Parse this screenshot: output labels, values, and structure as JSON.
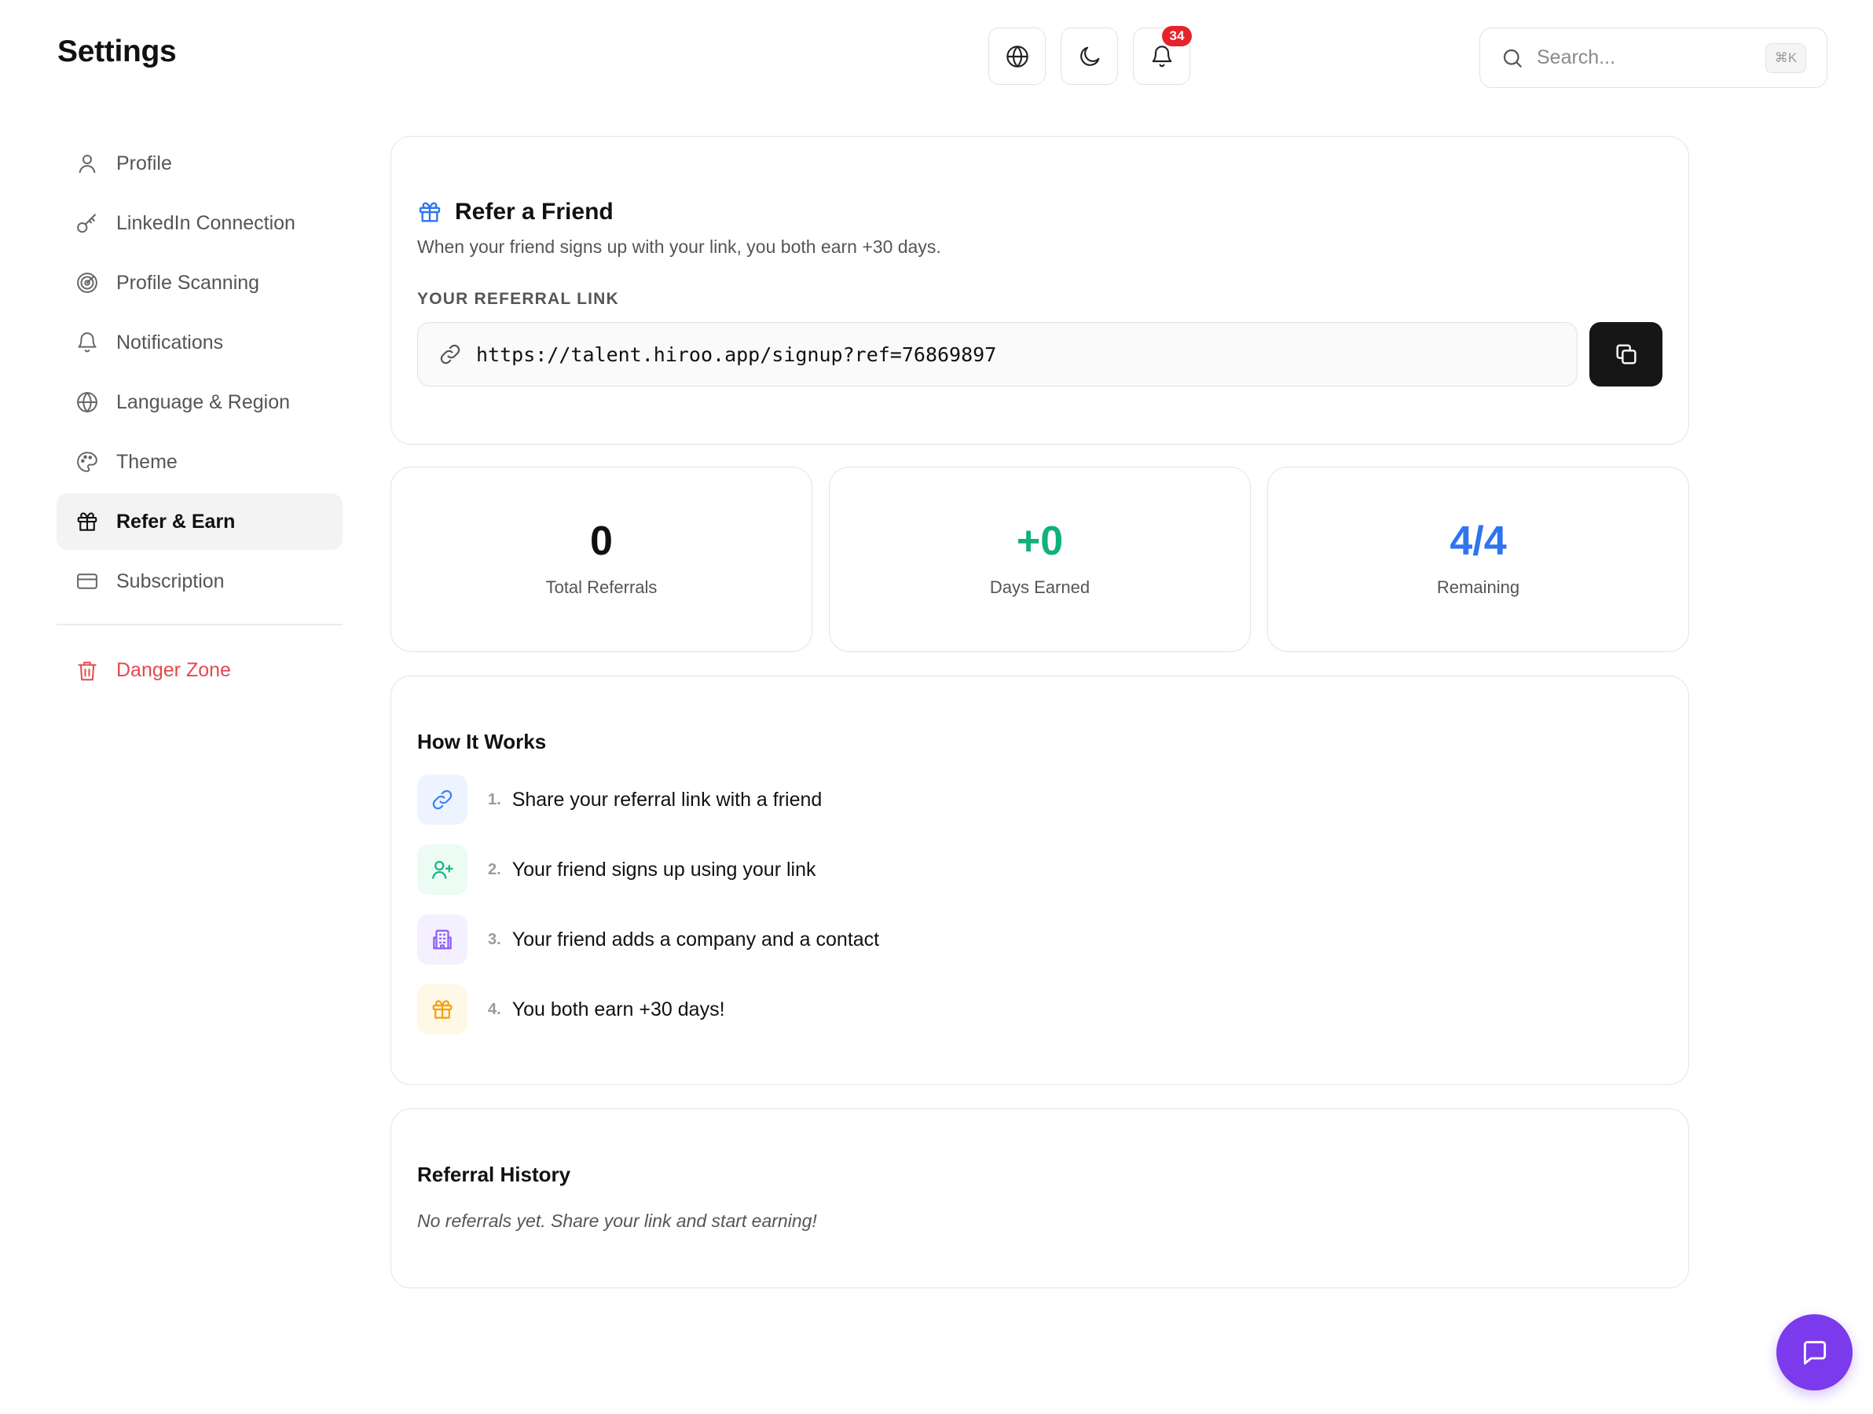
{
  "header": {
    "title": "Settings",
    "notifications_count": "34",
    "search_placeholder": "Search...",
    "search_shortcut": "⌘K"
  },
  "sidebar": {
    "items": [
      {
        "label": "Profile",
        "icon": "user-icon"
      },
      {
        "label": "LinkedIn Connection",
        "icon": "key-icon"
      },
      {
        "label": "Profile Scanning",
        "icon": "radar-icon"
      },
      {
        "label": "Notifications",
        "icon": "bell-icon"
      },
      {
        "label": "Language & Region",
        "icon": "globe-icon"
      },
      {
        "label": "Theme",
        "icon": "palette-icon"
      },
      {
        "label": "Refer & Earn",
        "icon": "gift-icon",
        "active": true
      },
      {
        "label": "Subscription",
        "icon": "credit-card-icon"
      }
    ],
    "danger": {
      "label": "Danger Zone",
      "icon": "trash-icon"
    }
  },
  "refer": {
    "title": "Refer a Friend",
    "subtitle": "When your friend signs up with your link, you both earn +30 days.",
    "link_label": "YOUR REFERRAL LINK",
    "url": "https://talent.hiroo.app/signup?ref=76869897"
  },
  "stats": [
    {
      "value": "0",
      "label": "Total Referrals",
      "color": "#111111"
    },
    {
      "value": "+0",
      "label": "Days Earned",
      "color": "#10b27a"
    },
    {
      "value": "4/4",
      "label": "Remaining",
      "color": "#2f74f0"
    }
  ],
  "how_it_works": {
    "title": "How It Works",
    "steps": [
      {
        "num": "1.",
        "text": "Share your referral link with a friend",
        "icon": "link-icon",
        "color": "#3b82f6",
        "bg": "#eef4ff"
      },
      {
        "num": "2.",
        "text": "Your friend signs up using your link",
        "icon": "user-plus-icon",
        "color": "#10b981",
        "bg": "#ecfbf4"
      },
      {
        "num": "3.",
        "text": "Your friend adds a company and a contact",
        "icon": "building-icon",
        "color": "#8b5cf6",
        "bg": "#f4f0ff"
      },
      {
        "num": "4.",
        "text": "You both earn +30 days!",
        "icon": "gift-icon",
        "color": "#f59e0b",
        "bg": "#fef8e7"
      }
    ]
  },
  "history": {
    "title": "Referral History",
    "empty": "No referrals yet. Share your link and start earning!"
  },
  "colors": {
    "accent": "#2f74f0",
    "danger": "#e5484d",
    "fab": "#7c3aed"
  }
}
